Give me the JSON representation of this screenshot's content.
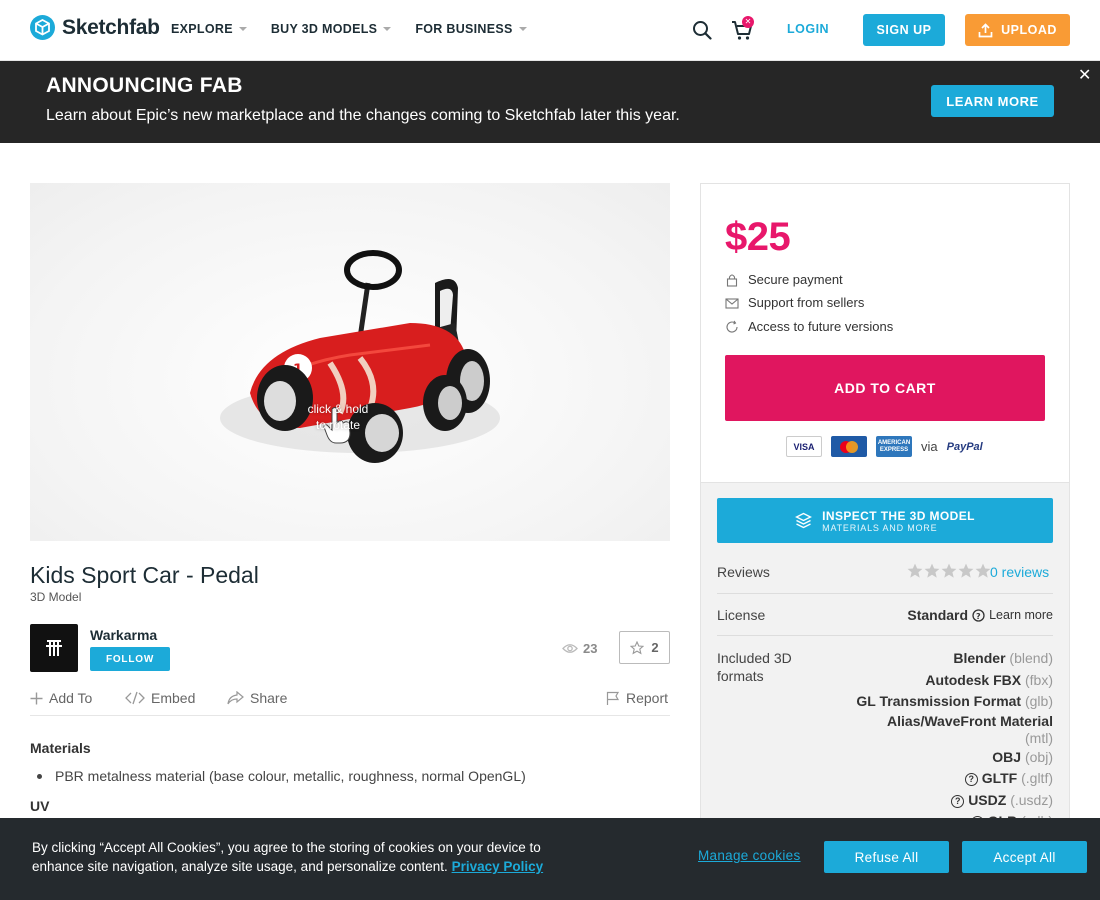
{
  "header": {
    "logo_text": "Sketchfab",
    "nav": [
      "EXPLORE",
      "BUY 3D MODELS",
      "FOR BUSINESS"
    ],
    "cart_badge": "✕",
    "login": "LOGIN",
    "signup": "SIGN UP",
    "upload": "UPLOAD",
    "icons": [
      "search-icon",
      "cart-icon",
      "upload-icon"
    ]
  },
  "announcement": {
    "title": "ANNOUNCING FAB",
    "text": "Learn about Epic’s new marketplace and the changes coming to Sketchfab later this year.",
    "button": "LEARN MORE",
    "close": "✕"
  },
  "viewer": {
    "hint_line1": "click & hold",
    "hint_line2": "to rotate"
  },
  "model": {
    "title": "Kids Sport Car - Pedal",
    "type": "3D Model",
    "author": "Warkarma",
    "follow": "FOLLOW",
    "views": "23",
    "likes": "2"
  },
  "actions": {
    "add_to": "Add To",
    "embed": "Embed",
    "share": "Share",
    "report": "Report"
  },
  "description": {
    "materials_heading": "Materials",
    "materials_item": "PBR metalness material (base colour, metallic, roughness, normal OpenGL)",
    "uv_heading": "UV"
  },
  "purchase": {
    "price": "$25",
    "perks": [
      "Secure payment",
      "Support from sellers",
      "Access to future versions"
    ],
    "add_to_cart": "ADD TO CART",
    "cards": [
      "VISA",
      "mastercard",
      "AMERICAN EXPRESS"
    ],
    "via": "via",
    "paypal": "PayPal"
  },
  "info": {
    "inspect_main": "INSPECT THE 3D MODEL",
    "inspect_sub": "MATERIALS AND MORE",
    "reviews_label": "Reviews",
    "reviews_link": "0 reviews",
    "license_label": "License",
    "license_value": "Standard",
    "license_learn": "Learn more",
    "formats_label": "Included 3D formats",
    "formats": [
      {
        "name": "Blender",
        "ext": "(blend)"
      },
      {
        "name": "Autodesk FBX",
        "ext": "(fbx)"
      },
      {
        "name": "GL Transmission Format",
        "ext": "(glb)"
      },
      {
        "name": "Alias/WaveFront Material",
        "ext": "(mtl)"
      },
      {
        "name": "OBJ",
        "ext": "(obj)"
      },
      {
        "name": "GLTF",
        "ext": "(.gltf)"
      },
      {
        "name": "USDZ",
        "ext": "(.usdz)"
      },
      {
        "name": "GLB",
        "ext": "(.glb)"
      }
    ]
  },
  "cookie": {
    "text": "By clicking “Accept All Cookies”, you agree to the storing of cookies on your device to enhance site navigation, analyze site usage, and personalize content.",
    "policy": "Privacy Policy",
    "manage": "Manage cookies",
    "refuse": "Refuse All",
    "accept": "Accept All"
  },
  "colors": {
    "brand_blue": "#1caad9",
    "price_pink": "#e8176b",
    "upload_orange": "#f99b35",
    "dark_banner": "#262626"
  }
}
